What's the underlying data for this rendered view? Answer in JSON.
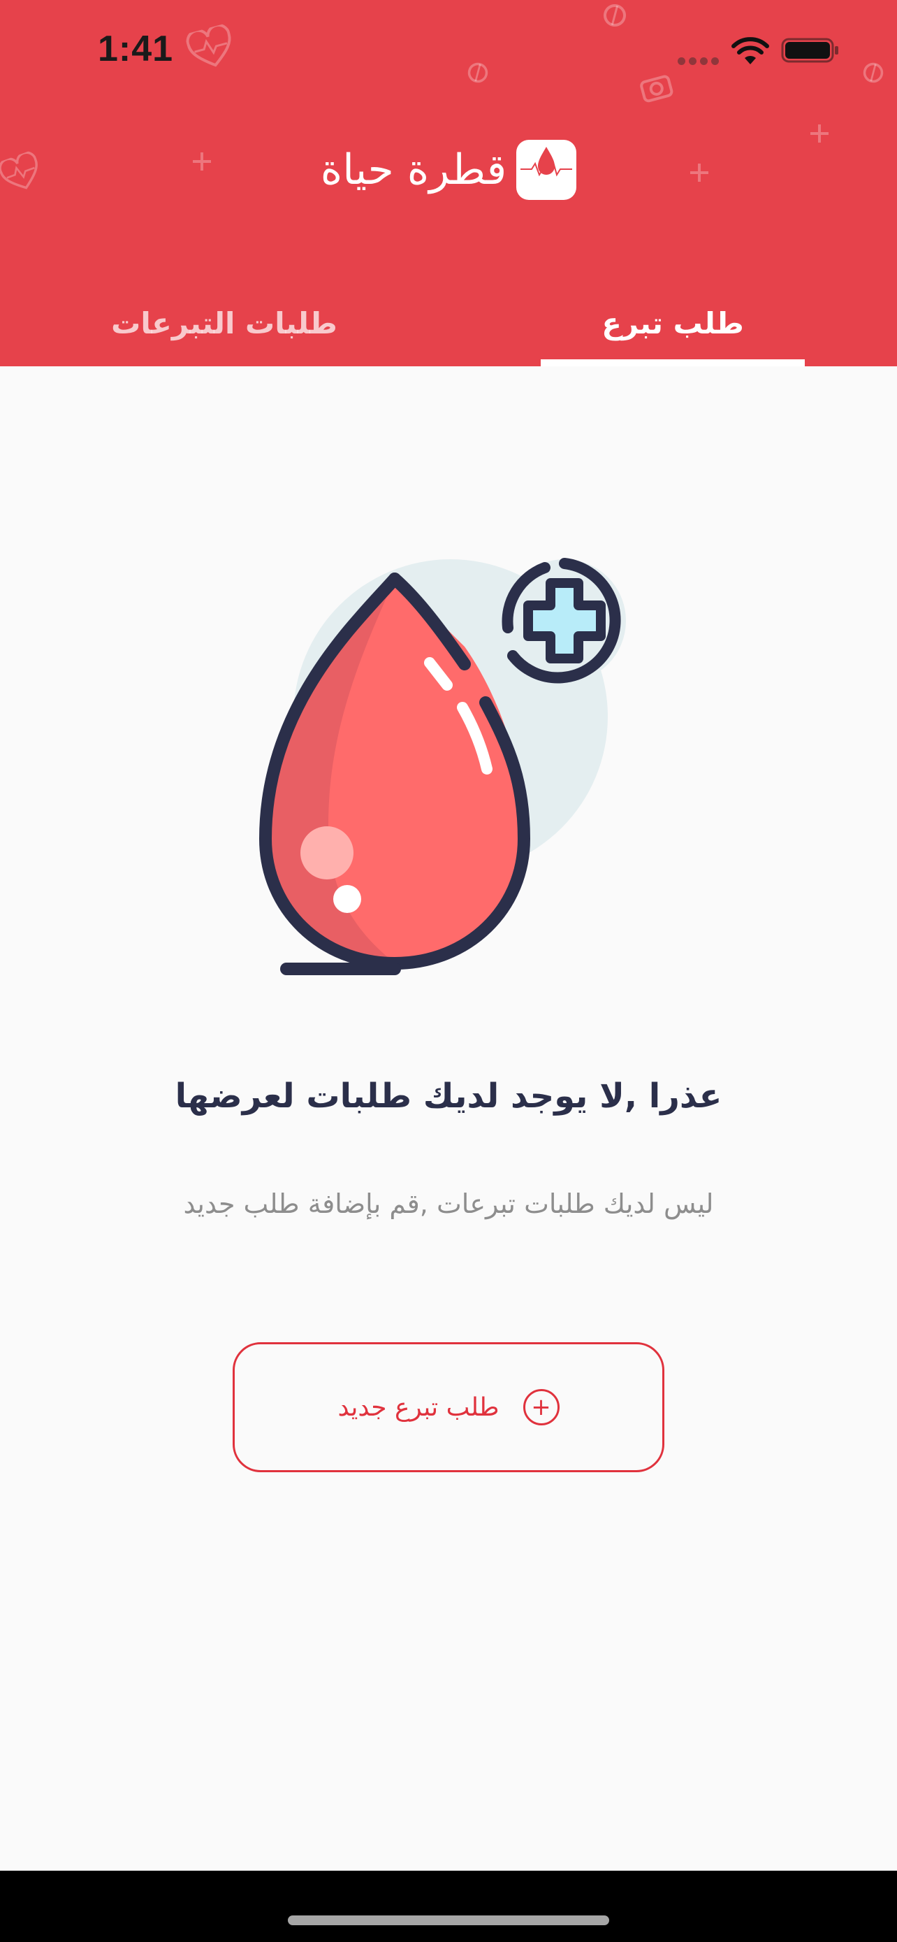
{
  "status_bar": {
    "time": "1:41"
  },
  "header": {
    "app_name": "قطرة حياة",
    "logo_caption": "قطرة حياة",
    "background_color": "#e6424b"
  },
  "tabs": [
    {
      "label": "طلب تبرع",
      "selected": true
    },
    {
      "label": "طلبات التبرعات",
      "selected": false
    }
  ],
  "empty_state": {
    "illustration": "blood-drop-with-medical-cross",
    "title": "عذرا ,لا يوجد لديك طلبات لعرضها",
    "subtitle": "ليس لديك طلبات تبرعات ,قم بإضافة طلب جديد"
  },
  "actions": {
    "new_request_label": "طلب تبرع جديد",
    "new_request_icon": "plus-circle-icon",
    "accent_color": "#e0323d"
  }
}
